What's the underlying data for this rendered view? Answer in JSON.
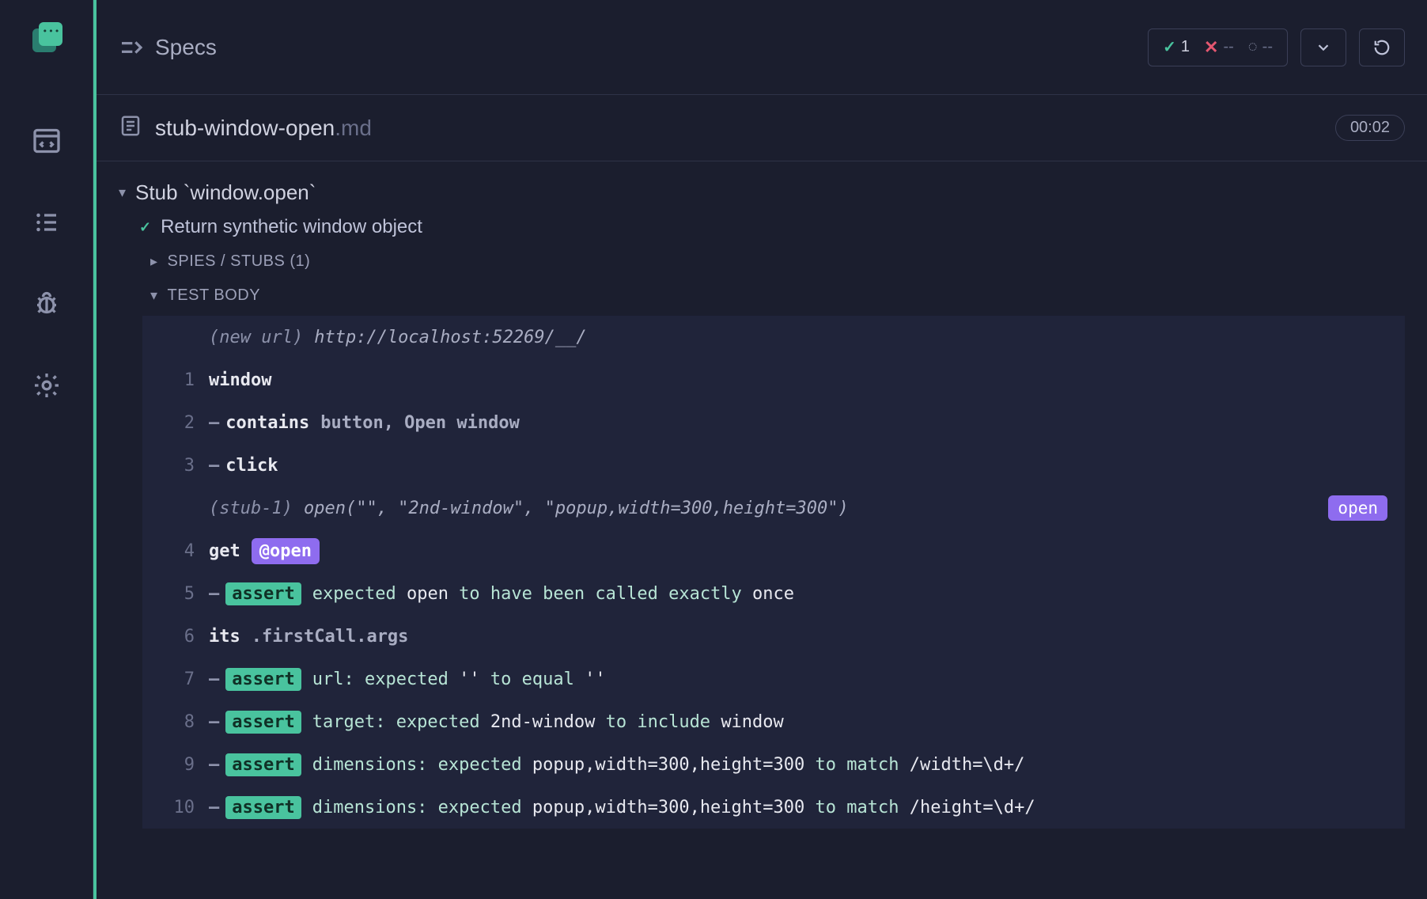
{
  "header": {
    "specsLabel": "Specs",
    "stats": {
      "passed": "1",
      "failed": "--",
      "pending": "--"
    }
  },
  "file": {
    "name": "stub-window-open",
    "ext": ".md",
    "duration": "00:02"
  },
  "suite": {
    "title": "Stub `window.open`",
    "test": {
      "title": "Return synthetic window object",
      "spiesLabel": "SPIES / STUBS (1)",
      "bodyLabel": "TEST BODY"
    }
  },
  "aliasTag": "open",
  "log": [
    {
      "num": "",
      "type": "event",
      "label": "(new url)",
      "args": "http://localhost:52269/__/"
    },
    {
      "num": "1",
      "type": "cmd",
      "dash": false,
      "name": "window",
      "args": ""
    },
    {
      "num": "2",
      "type": "cmd",
      "dash": true,
      "name": "contains",
      "args": "button, Open window"
    },
    {
      "num": "3",
      "type": "cmd",
      "dash": true,
      "name": "click",
      "args": ""
    },
    {
      "num": "",
      "type": "event",
      "label": "(stub-1)",
      "args": "open(\"\", \"2nd-window\", \"popup,width=300,height=300\")",
      "alias": "open"
    },
    {
      "num": "4",
      "type": "cmd",
      "dash": false,
      "name": "get",
      "alias": "@open"
    },
    {
      "num": "5",
      "type": "assert",
      "msgPre": "expected ",
      "msgHl": "open",
      "msgMid": " to have been called exactly ",
      "msgHl2": "once",
      "msgPost": ""
    },
    {
      "num": "6",
      "type": "cmd",
      "dash": false,
      "name": "its",
      "args": ".firstCall.args"
    },
    {
      "num": "7",
      "type": "assert",
      "msgPre": "url: expected  ",
      "msgHl": "''",
      "msgMid": "  to equal  ",
      "msgHl2": "''",
      "msgPost": ""
    },
    {
      "num": "8",
      "type": "assert",
      "msgPre": "target: expected  ",
      "msgHl": "2nd-window",
      "msgMid": "  to include  ",
      "msgHl2": "window",
      "msgPost": ""
    },
    {
      "num": "9",
      "type": "assert",
      "msgPre": "dimensions: expected  ",
      "msgHl": "popup,width=300,height=300",
      "msgMid": "  to match ",
      "msgHl2": "/width=\\d+/",
      "msgPost": ""
    },
    {
      "num": "10",
      "type": "assert",
      "msgPre": "dimensions: expected  ",
      "msgHl": "popup,width=300,height=300",
      "msgMid": "  to match ",
      "msgHl2": "/height=\\d+/",
      "msgPost": ""
    }
  ],
  "assertLabel": "assert"
}
